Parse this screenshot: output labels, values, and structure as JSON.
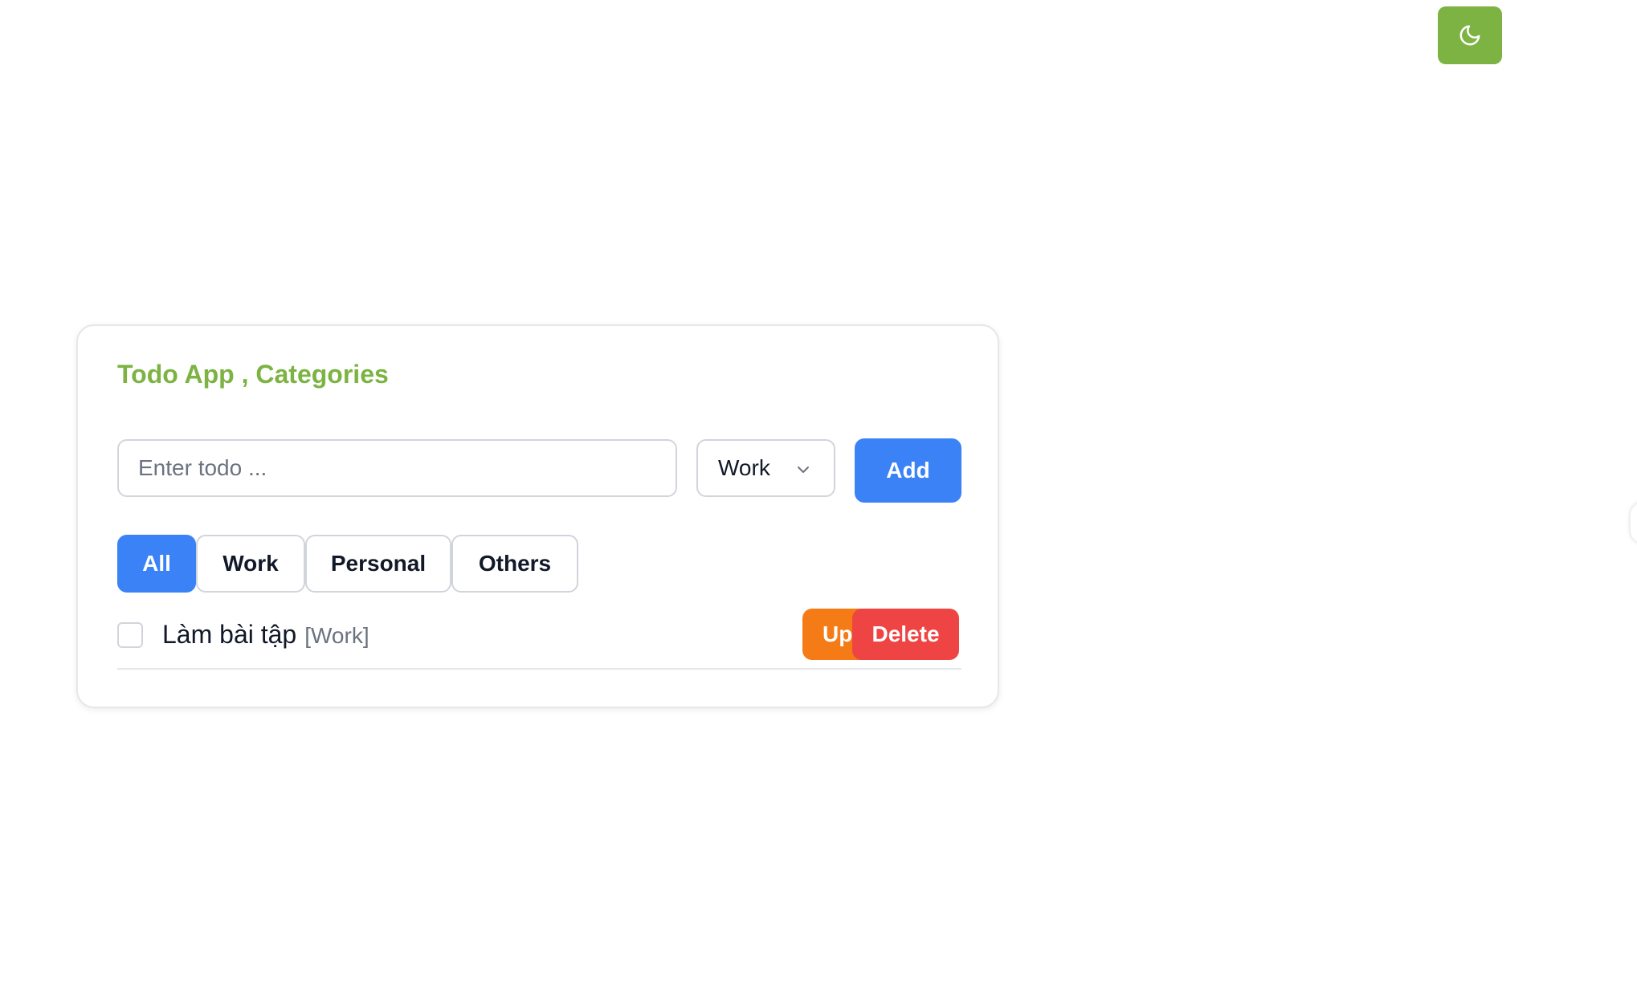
{
  "colors": {
    "brand_green": "#7cb342",
    "primary_blue": "#3b82f6",
    "update_orange": "#f47b16",
    "delete_red": "#ef4444"
  },
  "header": {
    "theme_toggle_icon": "moon-icon"
  },
  "app": {
    "title": "Todo App , Categories",
    "input": {
      "value": "",
      "placeholder": "Enter todo ..."
    },
    "category_select": {
      "selected": "Work",
      "icon": "chevron-down-icon"
    },
    "add_label": "Add"
  },
  "filters": {
    "active": "All",
    "tabs": [
      {
        "label": "All"
      },
      {
        "label": "Work"
      },
      {
        "label": "Personal"
      },
      {
        "label": "Others"
      }
    ]
  },
  "todos": [
    {
      "text": "Làm bài tập",
      "category": "[Work]",
      "checked": false,
      "update_label": "Update",
      "delete_label": "Delete"
    }
  ]
}
